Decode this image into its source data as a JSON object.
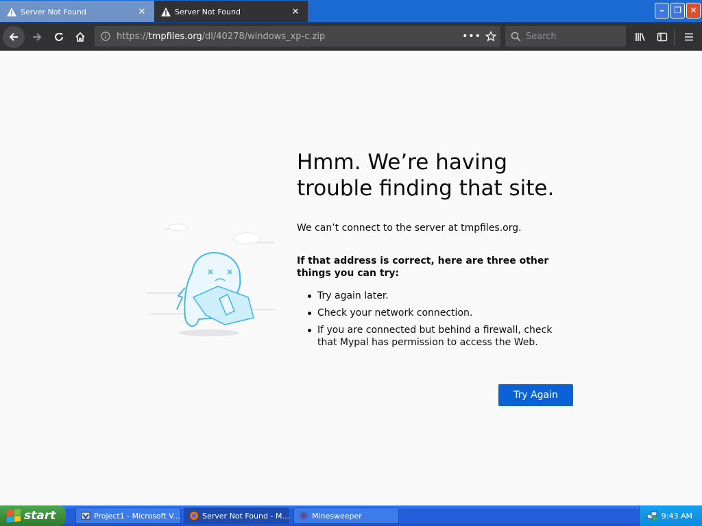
{
  "tabs": [
    {
      "title": "Server Not Found",
      "active": false
    },
    {
      "title": "Server Not Found",
      "active": true
    }
  ],
  "window_buttons": {
    "minimize": "–",
    "maximize": "❐",
    "close": "✕"
  },
  "navbar": {
    "url_prefix": "https://",
    "url_host": "tmpfiles.org",
    "url_path": "/dl/40278/windows_xp-c.zip",
    "page_actions": "•••",
    "search_placeholder": "Search"
  },
  "error_page": {
    "title": "Hmm. We’re having trouble finding that site.",
    "description": "We can’t connect to the server at tmpfiles.org.",
    "try_heading": "If that address is correct, here are three other things you can try:",
    "suggestions": [
      "Try again later.",
      "Check your network connection.",
      "If you are connected but behind a firewall, check that Mypal has permission to access the Web."
    ],
    "button_label": "Try Again"
  },
  "taskbar": {
    "start_label": "start",
    "tasks": [
      {
        "label": "Project1 - Microsoft V...",
        "active": false
      },
      {
        "label": "Server Not Found - M...",
        "active": true
      },
      {
        "label": "Minesweeper",
        "active": false
      }
    ],
    "clock": "9:43 AM"
  },
  "colors": {
    "accent_button": "#0a62d6",
    "toolbar_bg": "#323234",
    "titlebar_bg": "#1b6ad1",
    "page_bg": "#f9f9fa",
    "taskbar_bg": "#245edb",
    "start_green": "#3c8f3c"
  },
  "icons": {
    "tab": "warning-icon",
    "nav": [
      "back-arrow-icon",
      "forward-arrow-icon",
      "reload-icon",
      "home-icon"
    ],
    "url": [
      "info-icon",
      "bookmark-star-icon"
    ],
    "toolbar": [
      "search-icon",
      "library-icon",
      "sidebar-icon",
      "hamburger-menu-icon"
    ]
  }
}
